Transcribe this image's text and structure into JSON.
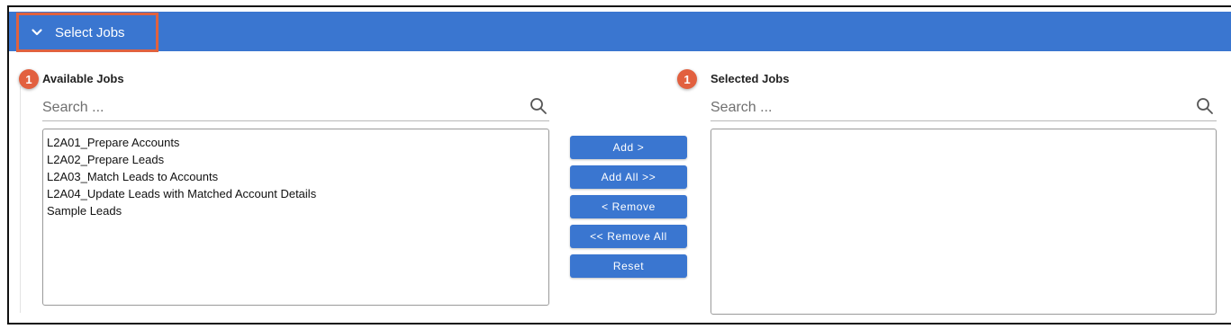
{
  "section": {
    "title": "Select Jobs",
    "toggle_icon": "chevron-down-icon"
  },
  "colors": {
    "header": "#3a76d0",
    "highlight": "#e0623f",
    "marker": "#e2603f",
    "button": "#3a76d0"
  },
  "available": {
    "marker": "1",
    "title": "Available Jobs",
    "search_placeholder": "Search ...",
    "items": [
      "L2A01_Prepare Accounts",
      "L2A02_Prepare Leads",
      "L2A03_Match Leads to Accounts",
      "L2A04_Update Leads with Matched Account Details",
      "Sample Leads"
    ]
  },
  "selected": {
    "marker": "1",
    "title": "Selected Jobs",
    "search_placeholder": "Search ...",
    "items": []
  },
  "actions": {
    "add": "Add >",
    "add_all": "Add All >>",
    "remove": "< Remove",
    "remove_all": "<< Remove All",
    "reset": "Reset"
  }
}
